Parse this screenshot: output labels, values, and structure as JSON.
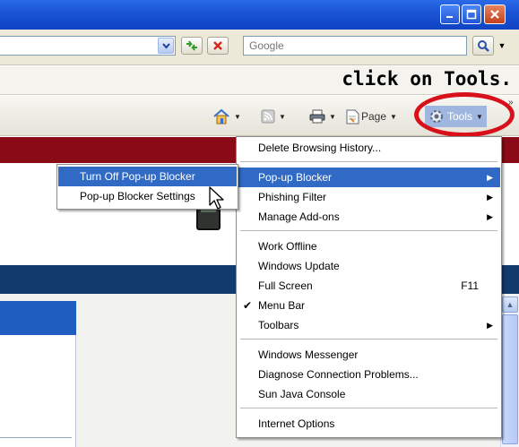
{
  "search": {
    "placeholder": "Google"
  },
  "annotation": {
    "text": "click on Tools."
  },
  "command_bar": {
    "page_label": "Page",
    "tools_label": "Tools"
  },
  "tools_menu": {
    "items": [
      {
        "label": "Delete Browsing History...",
        "shortcut": "",
        "submenu": false,
        "checked": false
      },
      {
        "label": "Pop-up Blocker",
        "shortcut": "",
        "submenu": true,
        "checked": false,
        "highlighted": true
      },
      {
        "label": "Phishing Filter",
        "shortcut": "",
        "submenu": true,
        "checked": false
      },
      {
        "label": "Manage Add-ons",
        "shortcut": "",
        "submenu": true,
        "checked": false
      },
      {
        "label": "Work Offline",
        "shortcut": "",
        "submenu": false,
        "checked": false
      },
      {
        "label": "Windows Update",
        "shortcut": "",
        "submenu": false,
        "checked": false
      },
      {
        "label": "Full Screen",
        "shortcut": "F11",
        "submenu": false,
        "checked": false
      },
      {
        "label": "Menu Bar",
        "shortcut": "",
        "submenu": false,
        "checked": true
      },
      {
        "label": "Toolbars",
        "shortcut": "",
        "submenu": true,
        "checked": false
      },
      {
        "label": "Windows Messenger",
        "shortcut": "",
        "submenu": false,
        "checked": false
      },
      {
        "label": "Diagnose Connection Problems...",
        "shortcut": "",
        "submenu": false,
        "checked": false
      },
      {
        "label": "Sun Java Console",
        "shortcut": "",
        "submenu": false,
        "checked": false
      },
      {
        "label": "Internet Options",
        "shortcut": "",
        "submenu": false,
        "checked": false
      }
    ]
  },
  "popup_submenu": {
    "items": [
      {
        "label": "Turn Off Pop-up Blocker",
        "highlighted": true
      },
      {
        "label": "Pop-up Blocker Settings",
        "highlighted": false
      }
    ]
  },
  "colors": {
    "titlebar": "#1953d3",
    "menu_highlight": "#316ac5",
    "annotation_ring": "#d8101a",
    "page_red_banner": "#8a0a17",
    "page_blue_banner": "#123a6c"
  },
  "icons": {
    "address_dropdown": "chevron-down-icon",
    "refresh": "refresh-icon",
    "stop": "stop-icon",
    "search": "magnifier-icon",
    "home": "home-icon",
    "feeds": "rss-feed-icon",
    "print": "printer-icon",
    "page": "page-icon",
    "tools": "gear-icon",
    "cursor": "mouse-pointer-icon"
  }
}
